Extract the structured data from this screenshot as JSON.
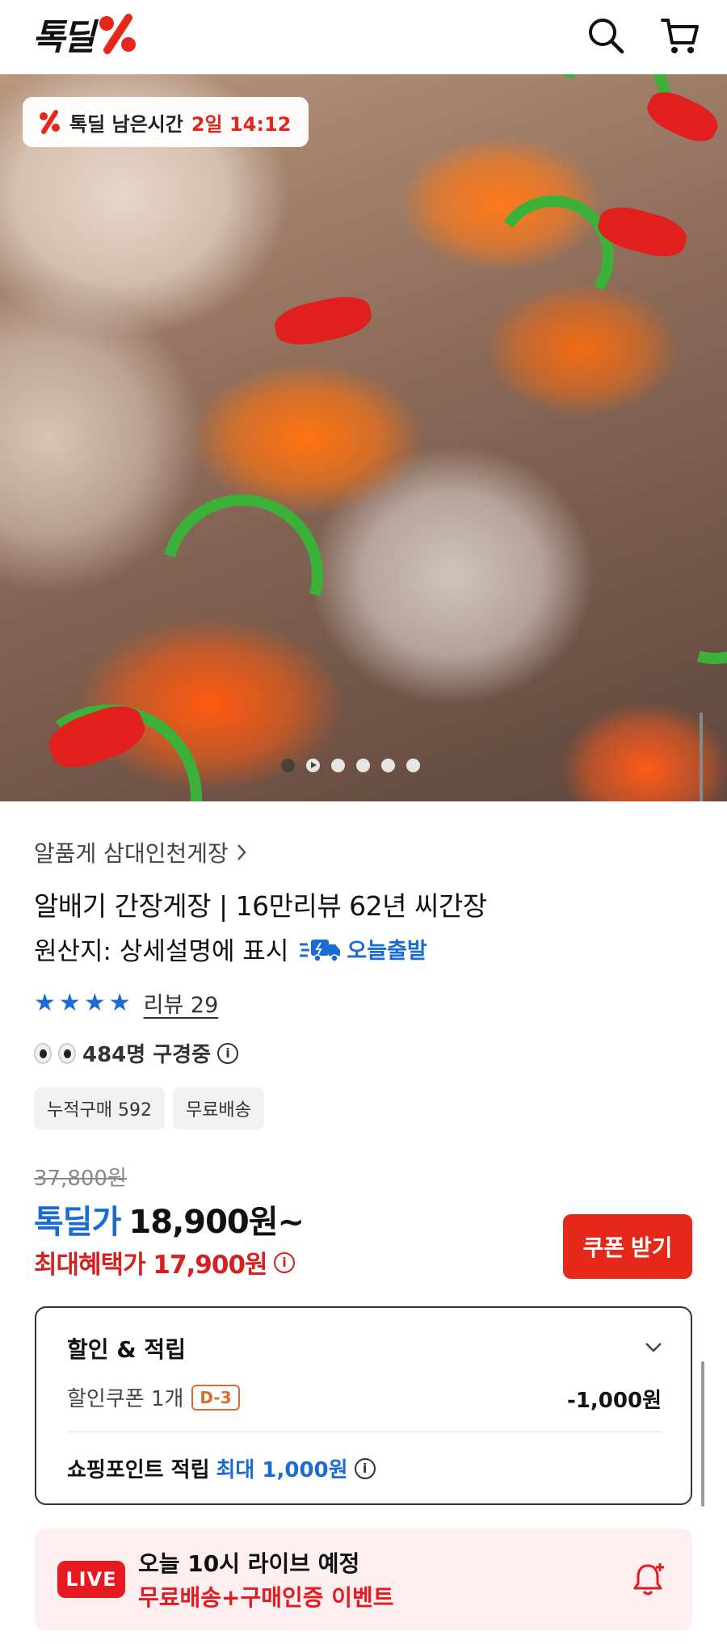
{
  "header": {
    "logo_text": "톡딜",
    "search_icon": "search-icon",
    "cart_icon": "cart-icon"
  },
  "hero": {
    "timer_label": "톡딜 남은시간",
    "timer_value": "2일 14:12",
    "slide_count": 6,
    "active_slide": 1
  },
  "product": {
    "seller": "알품게 삼대인천게장",
    "seller_chevron": "chevron-right-icon",
    "title": "알배기 간장게장 | 16만리뷰 62년 씨간장",
    "origin": "원산지: 상세설명에 표시",
    "today_ship": "오늘출발",
    "rating_stars": 4,
    "review_label": "리뷰 29",
    "viewers": "484명 구경중",
    "tags": [
      "누적구매 592",
      "무료배송"
    ]
  },
  "price": {
    "original": "37,800원",
    "deal_label": "톡딜가",
    "deal_price": "18,900원~",
    "max_benefit": "최대혜택가 17,900원",
    "coupon_button": "쿠폰 받기"
  },
  "benefits": {
    "title": "할인 & 적립",
    "coupon_label": "할인쿠폰 1개",
    "coupon_dday": "D-3",
    "coupon_amount": "-1,000원",
    "point_label": "쇼핑포인트 적립",
    "point_value": "최대 1,000원"
  },
  "live": {
    "badge": "LIVE",
    "title": "오늘 10시 라이브 예정",
    "subtitle": "무료배송+구매인증 이벤트"
  },
  "colors": {
    "accent_red": "#e5281a",
    "accent_blue": "#1a6bd4",
    "live_bg": "#fdeef0"
  }
}
